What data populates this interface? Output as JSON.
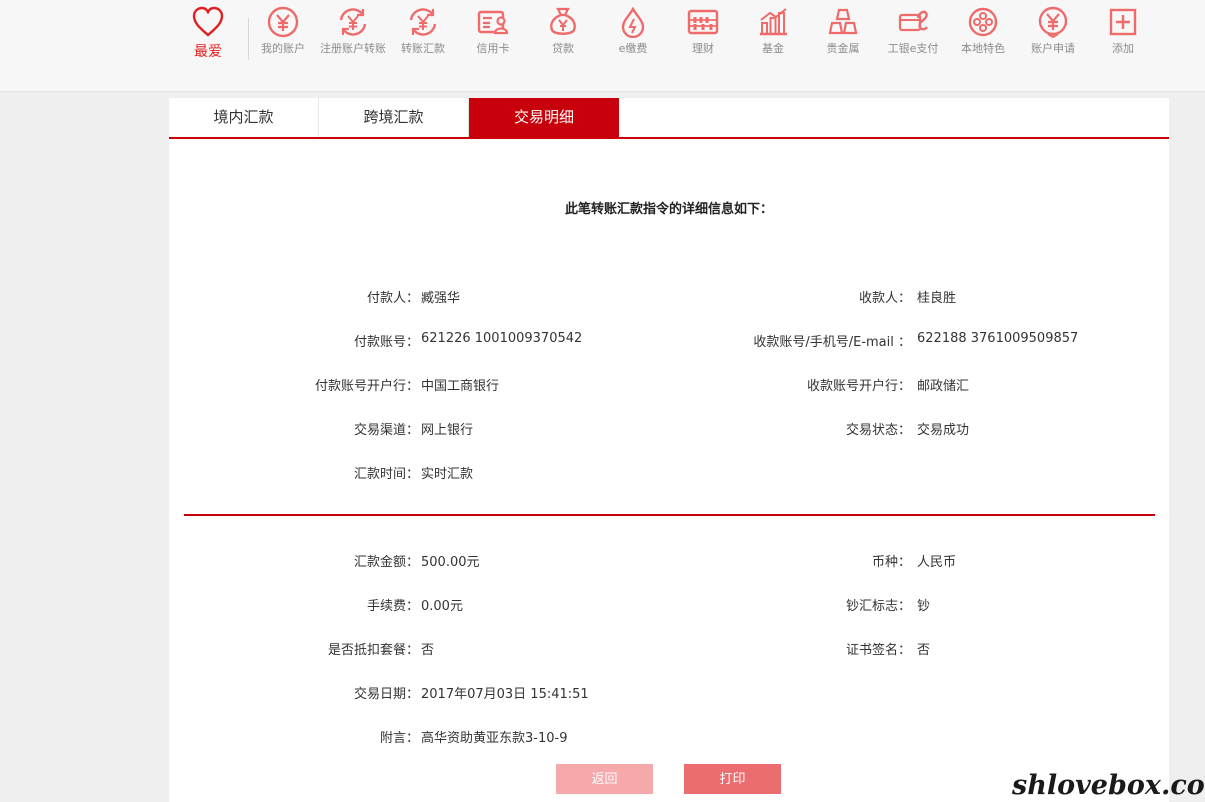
{
  "nav": {
    "favorite": {
      "label": "最爱",
      "icon": "heart-icon"
    },
    "items": [
      {
        "label": "我的账户",
        "icon": "yen-circle-icon"
      },
      {
        "label": "注册账户转账",
        "icon": "yen-exchange-icon"
      },
      {
        "label": "转账汇款",
        "icon": "yen-transfer-icon"
      },
      {
        "label": "信用卡",
        "icon": "credit-card-icon"
      },
      {
        "label": "贷款",
        "icon": "money-bag-icon"
      },
      {
        "label": "e缴费",
        "icon": "drop-icon"
      },
      {
        "label": "理财",
        "icon": "abacus-icon"
      },
      {
        "label": "基金",
        "icon": "bar-chart-icon"
      },
      {
        "label": "贵金属",
        "icon": "gold-bars-icon"
      },
      {
        "label": "工银e支付",
        "icon": "epay-icon"
      },
      {
        "label": "本地特色",
        "icon": "film-reel-icon"
      },
      {
        "label": "账户申请",
        "icon": "yen-apply-icon"
      },
      {
        "label": "添加",
        "icon": "add-icon"
      }
    ]
  },
  "tabs": [
    {
      "label": "境内汇款",
      "active": false
    },
    {
      "label": "跨境汇款",
      "active": false
    },
    {
      "label": "交易明细",
      "active": true
    }
  ],
  "heading": "此笔转账汇款指令的详细信息如下：",
  "section1": {
    "left": [
      {
        "label": "付款人：",
        "value": "臧强华"
      },
      {
        "label": "付款账号：",
        "value": "621226 1001009370542"
      },
      {
        "label": "付款账号开户行：",
        "value": "中国工商银行"
      },
      {
        "label": "交易渠道：",
        "value": "网上银行"
      },
      {
        "label": "汇款时间：",
        "value": "实时汇款"
      }
    ],
    "right": [
      {
        "label": "收款人：",
        "value": "桂良胜"
      },
      {
        "label": "收款账号/手机号/E-mail ：",
        "value": "622188 3761009509857"
      },
      {
        "label": "收款账号开户行：",
        "value": "邮政储汇"
      },
      {
        "label": "交易状态：",
        "value": "交易成功"
      }
    ]
  },
  "section2": {
    "left": [
      {
        "label": "汇款金额：",
        "value": "500.00元"
      },
      {
        "label": "手续费：",
        "value": "0.00元"
      },
      {
        "label": "是否抵扣套餐：",
        "value": "否"
      },
      {
        "label": "交易日期：",
        "value": "2017年07月03日 15:41:51"
      },
      {
        "label": "附言：",
        "value": "高华资助黄亚东款3-10-9"
      }
    ],
    "right": [
      {
        "label": "币种：",
        "value": "人民币"
      },
      {
        "label": "钞汇标志：",
        "value": "钞"
      },
      {
        "label": "证书签名：",
        "value": "否"
      }
    ]
  },
  "buttons": {
    "back": "返回",
    "print": "打印"
  },
  "watermark": "shlovebox.com",
  "colors": {
    "accent": "#c7000b",
    "icon": "#ef6b6b",
    "back_button": "#f6a9aa",
    "print_button": "#ec6d6f"
  }
}
